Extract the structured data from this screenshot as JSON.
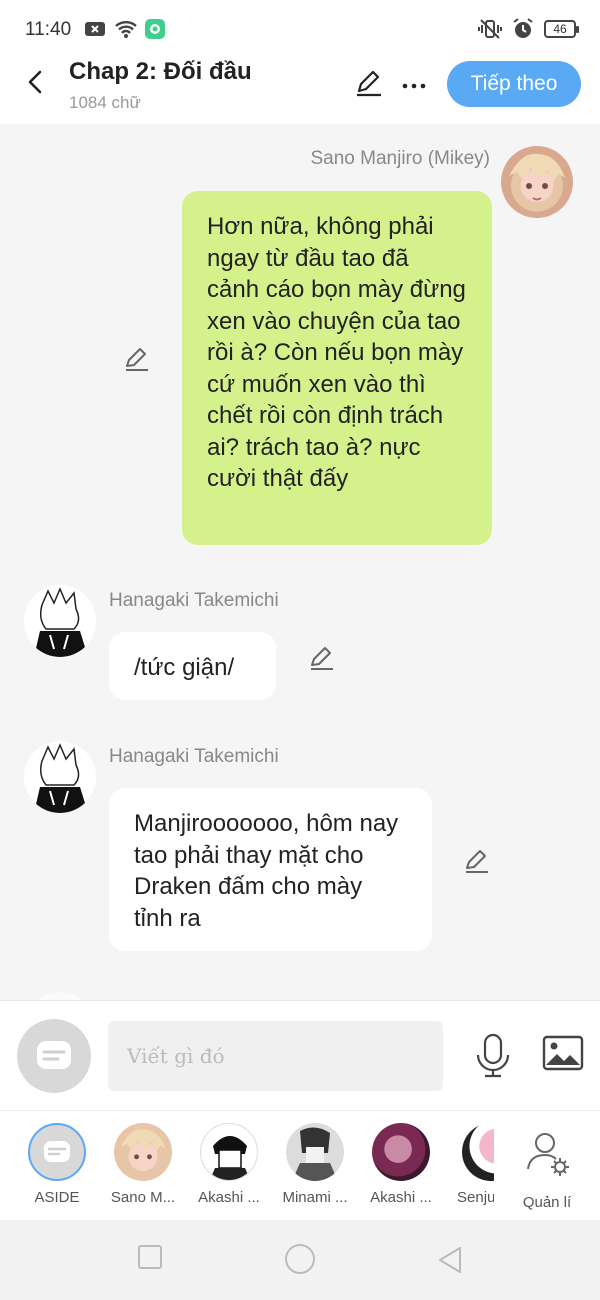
{
  "status_bar": {
    "time": "11:40",
    "battery": "46"
  },
  "header": {
    "title": "Chap 2: Đối đầu",
    "subtitle": "1084 chữ",
    "next_label": "Tiếp theo"
  },
  "messages": [
    {
      "sender": "Sano Manjiro (Mikey)",
      "text": "Hơn nữa, không phải ngay từ đầu tao đã cảnh cáo bọn mày đừng xen vào chuyện của tao rồi à? Còn nếu bọn mày cứ muốn xen vào thì chết rồi còn định trách ai? trách tao à? nực cười thật đấy"
    },
    {
      "sender": "Hanagaki Takemichi",
      "text": "/tức giận/"
    },
    {
      "sender": "Hanagaki Takemichi",
      "text": "Manjirooooooo, hôm nay tao phải thay mặt cho Draken đấm cho mày tỉnh ra"
    }
  ],
  "composer": {
    "placeholder": "Viết gì đó"
  },
  "characters": [
    {
      "label": "ASIDE"
    },
    {
      "label": "Sano M..."
    },
    {
      "label": "Akashi ..."
    },
    {
      "label": "Minami ..."
    },
    {
      "label": "Akashi ..."
    },
    {
      "label": "Senju"
    },
    {
      "label": "Quản lí"
    }
  ],
  "colors": {
    "accent": "#5aa9f5",
    "own_bubble": "#d5f18c",
    "other_bubble": "#ffffff"
  }
}
